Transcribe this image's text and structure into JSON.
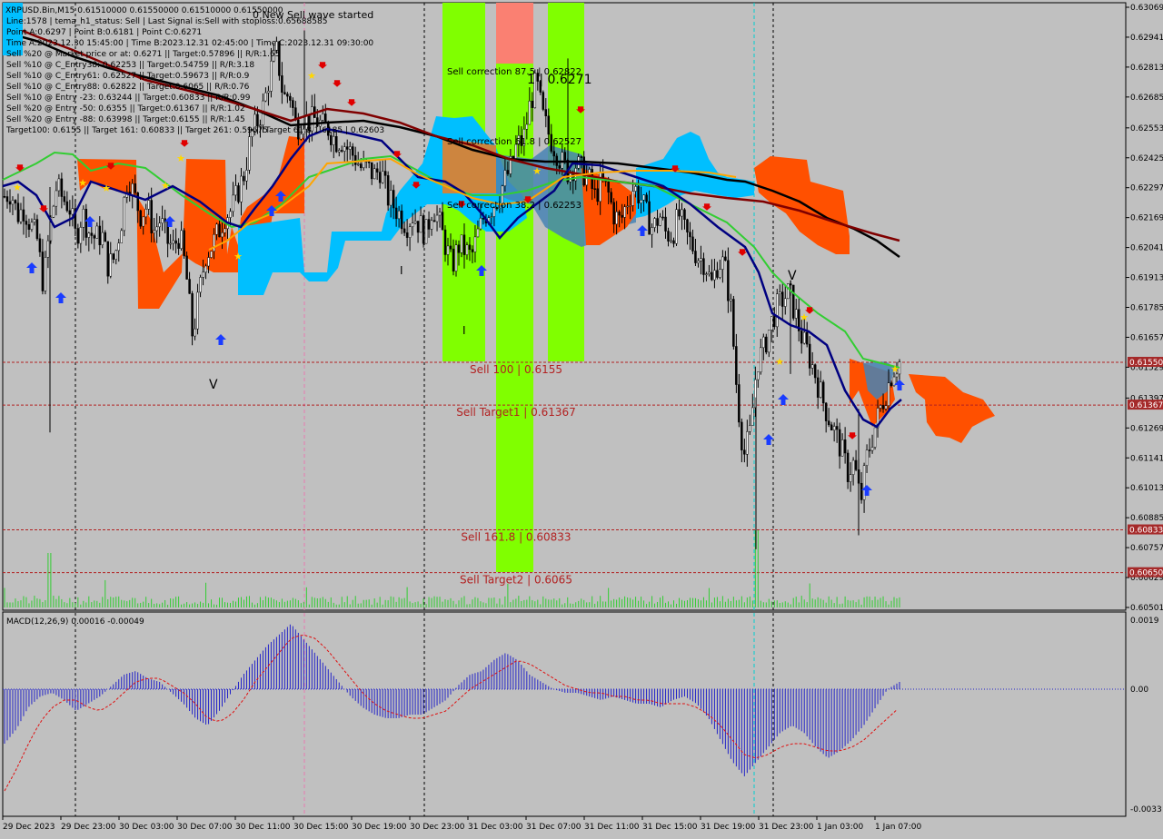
{
  "window": {
    "symbol_line": "XRPUSD.Bin,M15  0.61510000 0.61550000 0.61510000 0.61550000",
    "alert": "0 New Sell wave started"
  },
  "info_lines": [
    "Line:1578 | tema_h1_status: Sell | Last Signal is:Sell with stoploss:0.65688585",
    "Point A:0.6297 | Point B:0.6181 | Point C:0.6271",
    "Time A:2023.12.30 15:45:00 | Time B:2023.12.31 02:45:00 | Time C:2023.12.31 09:30:00",
    "Sell %20 @ Market price or at: 0.6271 || Target:0.57896 || R/R:1.65",
    "Sell %10 @ C_Entry38: 0.62253 || Target:0.54759 || R/R:3.18",
    "Sell %10 @ C_Entry61: 0.62527 || Target:0.59673 || R/R:0.9",
    "Sell %10 @ C_Entry88: 0.62822 || Target:0.6065 || R/R:0.76",
    "Sell %10 @ Entry -23: 0.63244 || Target:0.60833 || R/R:0.99",
    "Sell %20 @ Entry -50: 0.6355 || Target:0.61367 || R/R:1.02",
    "Sell %20 @ Entry -88: 0.63998 || Target:0.6155 || R/R:1.45",
    "Target100: 0.6155 || Target 161: 0.60833 || Target 261: 0.59675"
  ],
  "levels": [
    {
      "label": "Sell 100 | 0.6155",
      "price": 0.6155,
      "badge": "0.61550"
    },
    {
      "label": "Sell Target1 | 0.61367",
      "price": 0.61367,
      "badge": "0.61367"
    },
    {
      "label": "Sell 161.8 | 0.60833",
      "price": 0.60833,
      "badge": "0.60833"
    },
    {
      "label": "Sell Target2 | 0.6065",
      "price": 0.6065,
      "badge": "0.60650"
    }
  ],
  "fib_labels": [
    "Sell correction 87.5 | 0.62822",
    "Sell correction 61.8 | 0.62527",
    "Sell correction 38.2 | 0.62253"
  ],
  "point_c_label": "1 | 0.6271",
  "wave_marks": [
    "V",
    "I",
    "I",
    "V"
  ],
  "overlay_label": "Target 61.8 1.6185 | 0.62603",
  "macd": {
    "label": "MACD(12,26,9) 0.00016 -0.00049",
    "ticks": [
      "0.0019",
      "0.00",
      "-0.0033"
    ]
  },
  "colors": {
    "bg": "#c0c0c0",
    "macd_hist": "#2424c8",
    "macd_signal": "#e01010",
    "sell_arrow": "#e00000",
    "buy_arrow": "#1a3cff",
    "cloud_orange": "#ff5000",
    "cloud_cyan": "#00bfff",
    "lime": "#80ff00",
    "salmon": "#fa8072",
    "ma_green": "#32cd32",
    "ma_navy": "#000080",
    "ma_maroon": "#800000",
    "ma_black": "#000000",
    "ma_orange": "#ffa500"
  },
  "chart_data": [
    {
      "type": "candlestick",
      "title": "XRPUSD.Bin,M15",
      "ylim": [
        0.60501,
        0.63069
      ],
      "y_ticks": [
        "0.63069",
        "0.62941",
        "0.62813",
        "0.62685",
        "0.62553",
        "0.62425",
        "0.62297",
        "0.62169",
        "0.62041",
        "0.61913",
        "0.61785",
        "0.61657",
        "0.61529",
        "0.61397",
        "0.61269",
        "0.61141",
        "0.61013",
        "0.60885",
        "0.60757",
        "0.60629",
        "0.60501"
      ],
      "x_ticks": [
        "29 Dec 2023",
        "29 Dec 23:00",
        "30 Dec 03:00",
        "30 Dec 07:00",
        "30 Dec 11:00",
        "30 Dec 15:00",
        "30 Dec 19:00",
        "30 Dec 23:00",
        "31 Dec 03:00",
        "31 Dec 07:00",
        "31 Dec 11:00",
        "31 Dec 15:00",
        "31 Dec 19:00",
        "31 Dec 23:00",
        "1 Jan 03:00",
        "1 Jan 07:00"
      ],
      "close_path": [
        0.6226,
        0.6228,
        0.6218,
        0.6221,
        0.6214,
        0.6208,
        0.6188,
        0.6213,
        0.623,
        0.6225,
        0.6222,
        0.6208,
        0.6219,
        0.6211,
        0.6208,
        0.621,
        0.6196,
        0.62,
        0.6215,
        0.6235,
        0.6226,
        0.6218,
        0.6222,
        0.6211,
        0.6216,
        0.6207,
        0.6204,
        0.621,
        0.6193,
        0.6166,
        0.6184,
        0.6201,
        0.6205,
        0.6211,
        0.6218,
        0.622,
        0.6228,
        0.6236,
        0.6252,
        0.6258,
        0.6265,
        0.628,
        0.6288,
        0.6268,
        0.627,
        0.6255,
        0.626,
        0.6258,
        0.6259,
        0.6256,
        0.6255,
        0.625,
        0.625,
        0.6246,
        0.6243,
        0.6238,
        0.6238,
        0.6235,
        0.6238,
        0.6226,
        0.6222,
        0.6218,
        0.6214,
        0.6218,
        0.6214,
        0.621,
        0.6222,
        0.6215,
        0.6205,
        0.6196,
        0.6205,
        0.6203,
        0.62,
        0.621,
        0.6218,
        0.6221,
        0.6225,
        0.6232,
        0.6238,
        0.6248,
        0.625,
        0.6265,
        0.6275,
        0.626,
        0.6252,
        0.6246,
        0.624,
        0.6236,
        0.624,
        0.6237,
        0.6234,
        0.6226,
        0.6232,
        0.6228,
        0.6218,
        0.6215,
        0.6224,
        0.623,
        0.6226,
        0.6218,
        0.6212,
        0.6218,
        0.621,
        0.621,
        0.6218,
        0.621,
        0.6205,
        0.62,
        0.6198,
        0.6188,
        0.6198,
        0.6197,
        0.6178,
        0.614,
        0.6115,
        0.6125,
        0.6155,
        0.616,
        0.617,
        0.6178,
        0.6182,
        0.6185,
        0.6175,
        0.6165,
        0.6158,
        0.615,
        0.614,
        0.6132,
        0.6125,
        0.6118,
        0.6108,
        0.6112,
        0.6095,
        0.6115,
        0.6125,
        0.6135,
        0.6143,
        0.6152,
        0.6155
      ],
      "series": [
        {
          "name": "MACD(12,26,9)",
          "values": [
            -0.0015,
            -0.0011,
            -0.0005,
            -0.0002,
            -0.0001,
            -0.0003,
            -0.0006,
            -0.0004,
            -0.0002,
            0.0001,
            0.0004,
            0.0005,
            0.0003,
            0.0002,
            -0.0001,
            -0.0004,
            -0.0008,
            -0.001,
            -0.0006,
            -0.0001,
            0.0004,
            0.0008,
            0.0012,
            0.0015,
            0.0018,
            0.0014,
            0.001,
            0.0006,
            0.0002,
            -0.0002,
            -0.0005,
            -0.0007,
            -0.0008,
            -0.0008,
            -0.0007,
            -0.0007,
            -0.0005,
            -0.0003,
            0.0001,
            0.0004,
            0.0005,
            0.0008,
            0.001,
            0.0008,
            0.0004,
            0.0002,
            0.0,
            -0.0001,
            -0.0001,
            -0.0002,
            -0.0003,
            -0.0002,
            -0.0003,
            -0.0004,
            -0.0004,
            -0.0005,
            -0.0003,
            -0.0002,
            -0.0004,
            -0.0008,
            -0.0014,
            -0.002,
            -0.0024,
            -0.002,
            -0.0016,
            -0.0012,
            -0.001,
            -0.0012,
            -0.0016,
            -0.0019,
            -0.0017,
            -0.0014,
            -0.001,
            -0.0005,
            0.0,
            0.0002
          ]
        },
        {
          "name": "Signal",
          "values": [
            -0.0028,
            -0.0022,
            -0.0015,
            -0.0009,
            -0.0005,
            -0.0003,
            -0.0003,
            -0.0005,
            -0.0006,
            -0.0004,
            -0.0001,
            0.0002,
            0.0003,
            0.0003,
            0.0001,
            -0.0001,
            -0.0004,
            -0.0008,
            -0.0009,
            -0.0007,
            -0.0003,
            0.0002,
            0.0006,
            0.001,
            0.0014,
            0.0015,
            0.0014,
            0.0011,
            0.0007,
            0.0003,
            -0.0001,
            -0.0004,
            -0.0006,
            -0.0007,
            -0.0008,
            -0.0008,
            -0.0007,
            -0.0006,
            -0.0003,
            0.0,
            0.0002,
            0.0004,
            0.0006,
            0.0008,
            0.0007,
            0.0005,
            0.0003,
            0.0001,
            0.0,
            -0.0001,
            -0.0001,
            -0.0002,
            -0.0002,
            -0.0003,
            -0.0003,
            -0.0004,
            -0.0004,
            -0.0004,
            -0.0005,
            -0.0007,
            -0.001,
            -0.0014,
            -0.0018,
            -0.0019,
            -0.0018,
            -0.0016,
            -0.0015,
            -0.0015,
            -0.0016,
            -0.0017,
            -0.0017,
            -0.0016,
            -0.0014,
            -0.0011,
            -0.0008,
            -0.0005
          ]
        }
      ]
    }
  ]
}
